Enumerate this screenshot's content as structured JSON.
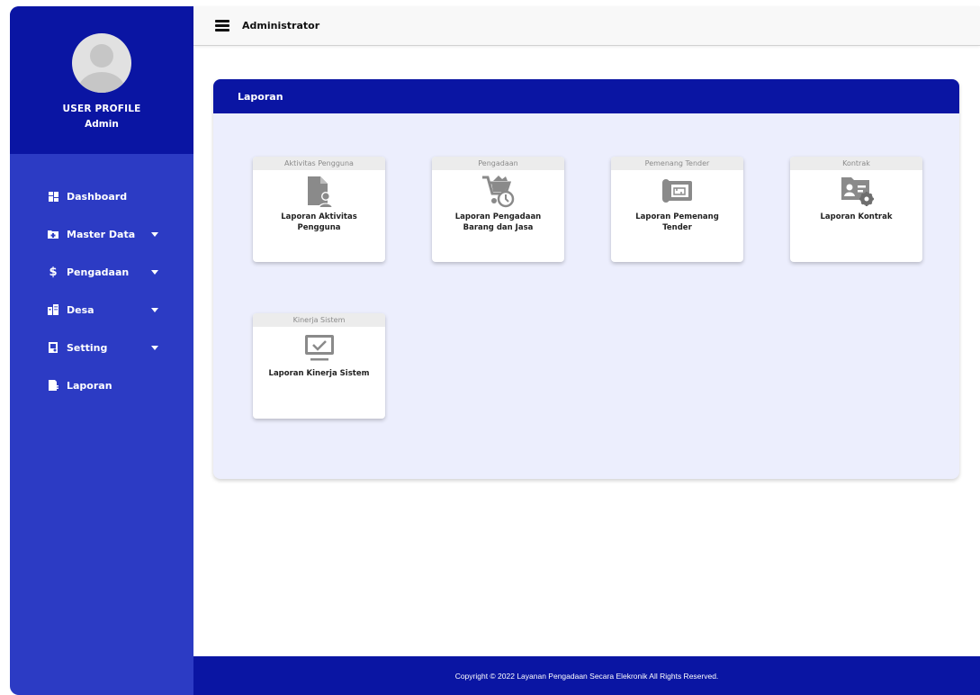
{
  "header": {
    "title": "Administrator"
  },
  "profile": {
    "title": "USER PROFILE",
    "name": "Admin"
  },
  "sidebar": {
    "items": [
      {
        "label": "Dashboard",
        "icon": "dashboard-icon",
        "has_submenu": false
      },
      {
        "label": "Master Data",
        "icon": "folder-plus-icon",
        "has_submenu": true
      },
      {
        "label": "Pengadaan",
        "icon": "dollar-icon",
        "has_submenu": true
      },
      {
        "label": "Desa",
        "icon": "city-icon",
        "has_submenu": true
      },
      {
        "label": "Setting",
        "icon": "settings-file-icon",
        "has_submenu": true
      },
      {
        "label": "Laporan",
        "icon": "report-icon",
        "has_submenu": false
      }
    ]
  },
  "panel": {
    "title": "Laporan"
  },
  "tiles": [
    {
      "category": "Aktivitas Pengguna",
      "label": "Laporan Aktivitas Pengguna",
      "icon": "user-document-icon"
    },
    {
      "category": "Pengadaan",
      "label": "Laporan Pengadaan Barang dan Jasa",
      "icon": "cart-clock-icon"
    },
    {
      "category": "Pemenang Tender",
      "label": "Laporan Pemenang Tender",
      "icon": "blueprint-icon"
    },
    {
      "category": "Kontrak",
      "label": "Laporan Kontrak",
      "icon": "contract-settings-icon"
    },
    {
      "category": "Kinerja Sistem",
      "label": "Laporan Kinerja Sistem",
      "icon": "monitor-check-icon"
    }
  ],
  "footer": {
    "text": "Copyright © 2022 Layanan Pengadaan Secara Elekronik All Rights Reserved."
  },
  "colors": {
    "sidebar": "#2c3bc4",
    "accent": "#0a15a3",
    "panel_bg": "#eceefd",
    "icon_gray": "#8a8a8a"
  }
}
